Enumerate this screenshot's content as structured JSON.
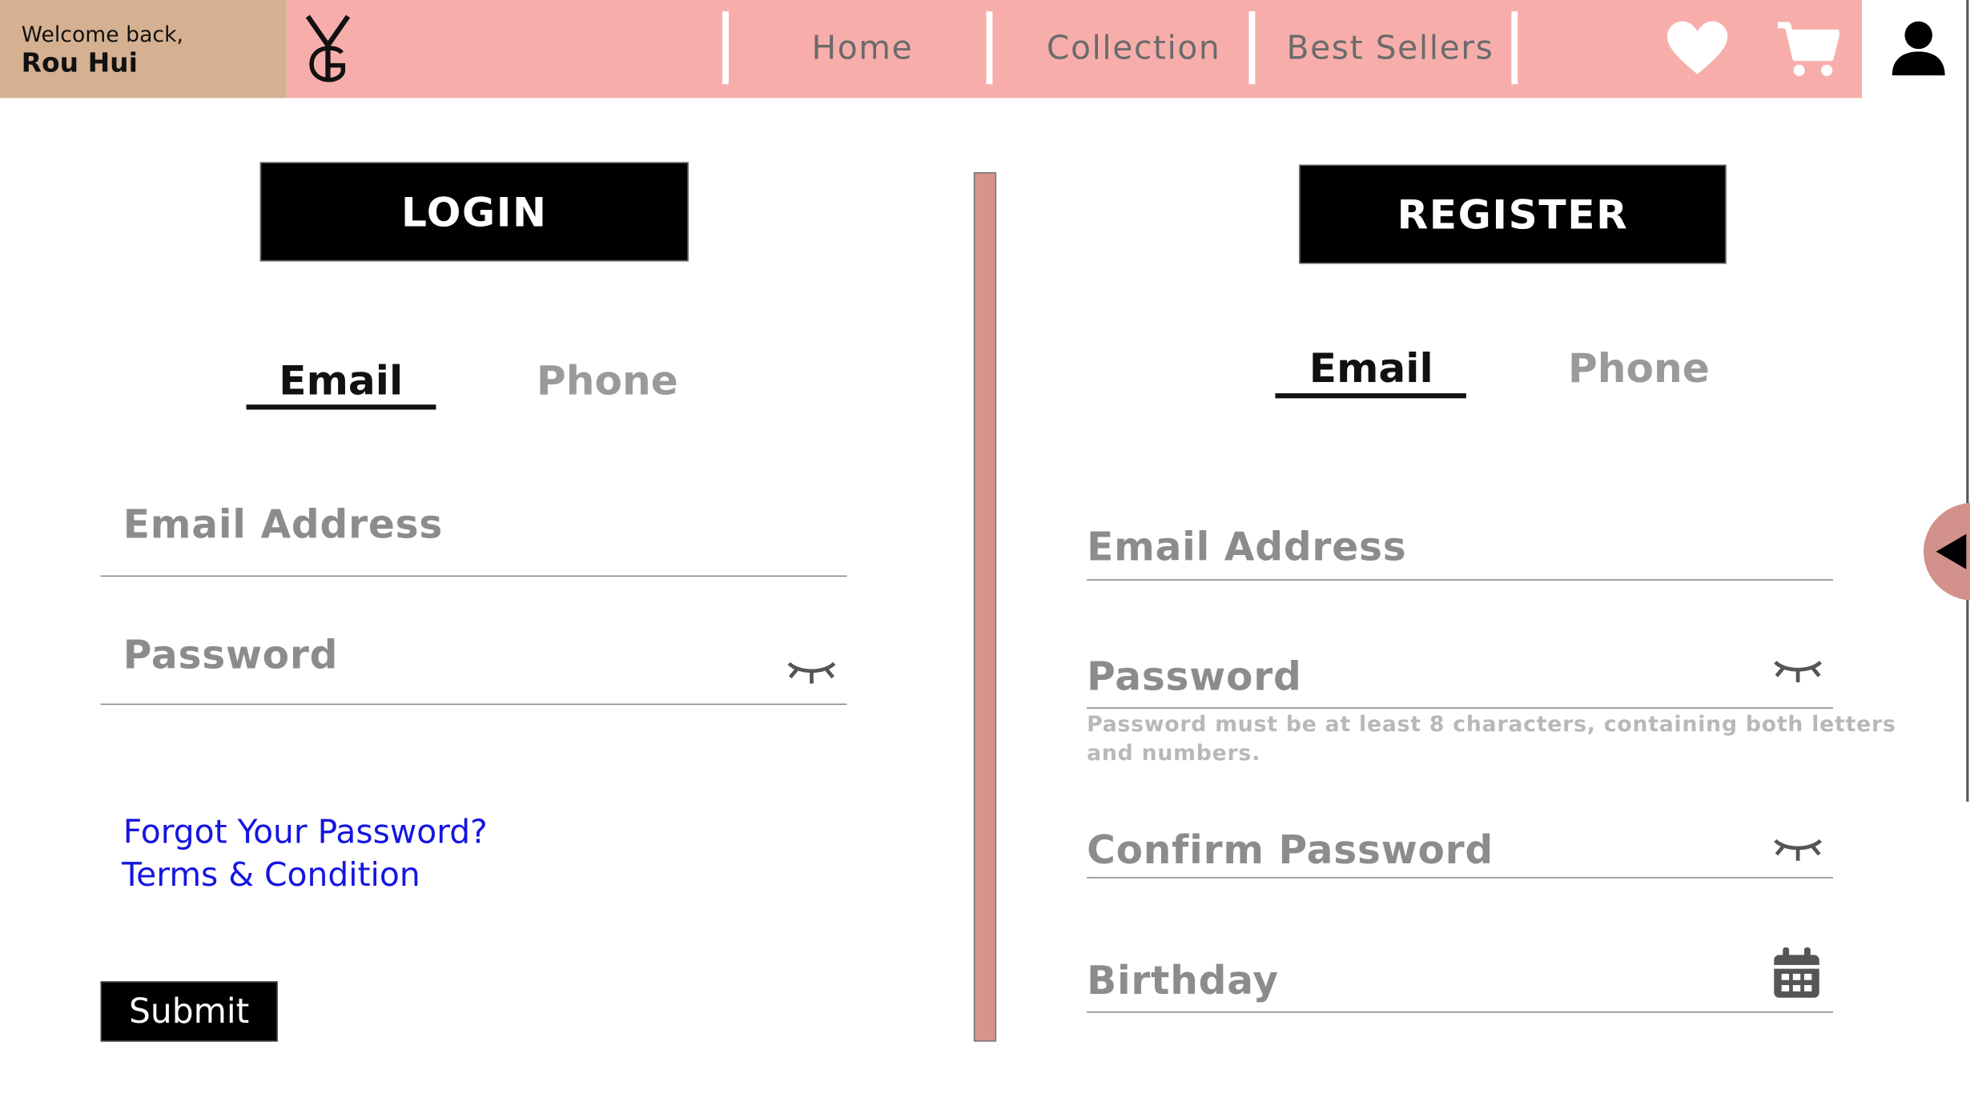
{
  "header": {
    "welcome_line": "Welcome back,",
    "user_name": "Rou  Hui",
    "nav": [
      "Home",
      "Collection",
      "Best Sellers"
    ],
    "colors": {
      "nav_bg": "#f7aeab",
      "welcome_bg": "#d5b191"
    },
    "icons": [
      "logo-icon",
      "heart-icon",
      "cart-icon",
      "user-icon"
    ]
  },
  "login": {
    "title": "LOGIN",
    "tabs": [
      "Email",
      "Phone"
    ],
    "active_tab": "Email",
    "email_placeholder": "Email Address",
    "password_placeholder": "Password",
    "links": [
      "Forgot Your Password?",
      "Terms & Condition"
    ],
    "submit_label": "Submit"
  },
  "register": {
    "title": "REGISTER",
    "tabs": [
      "Email",
      "Phone"
    ],
    "active_tab": "Email",
    "email_placeholder": "Email Address",
    "password_placeholder": "Password",
    "password_hint_line1": "Password must be at least 8 characters, containing both letters",
    "password_hint_line2": "and numbers.",
    "confirm_placeholder": "Confirm Password",
    "birthday_placeholder": "Birthday"
  },
  "colors": {
    "accent": "#d9938d",
    "link": "#1515e0",
    "muted": "#8c8c8c"
  }
}
